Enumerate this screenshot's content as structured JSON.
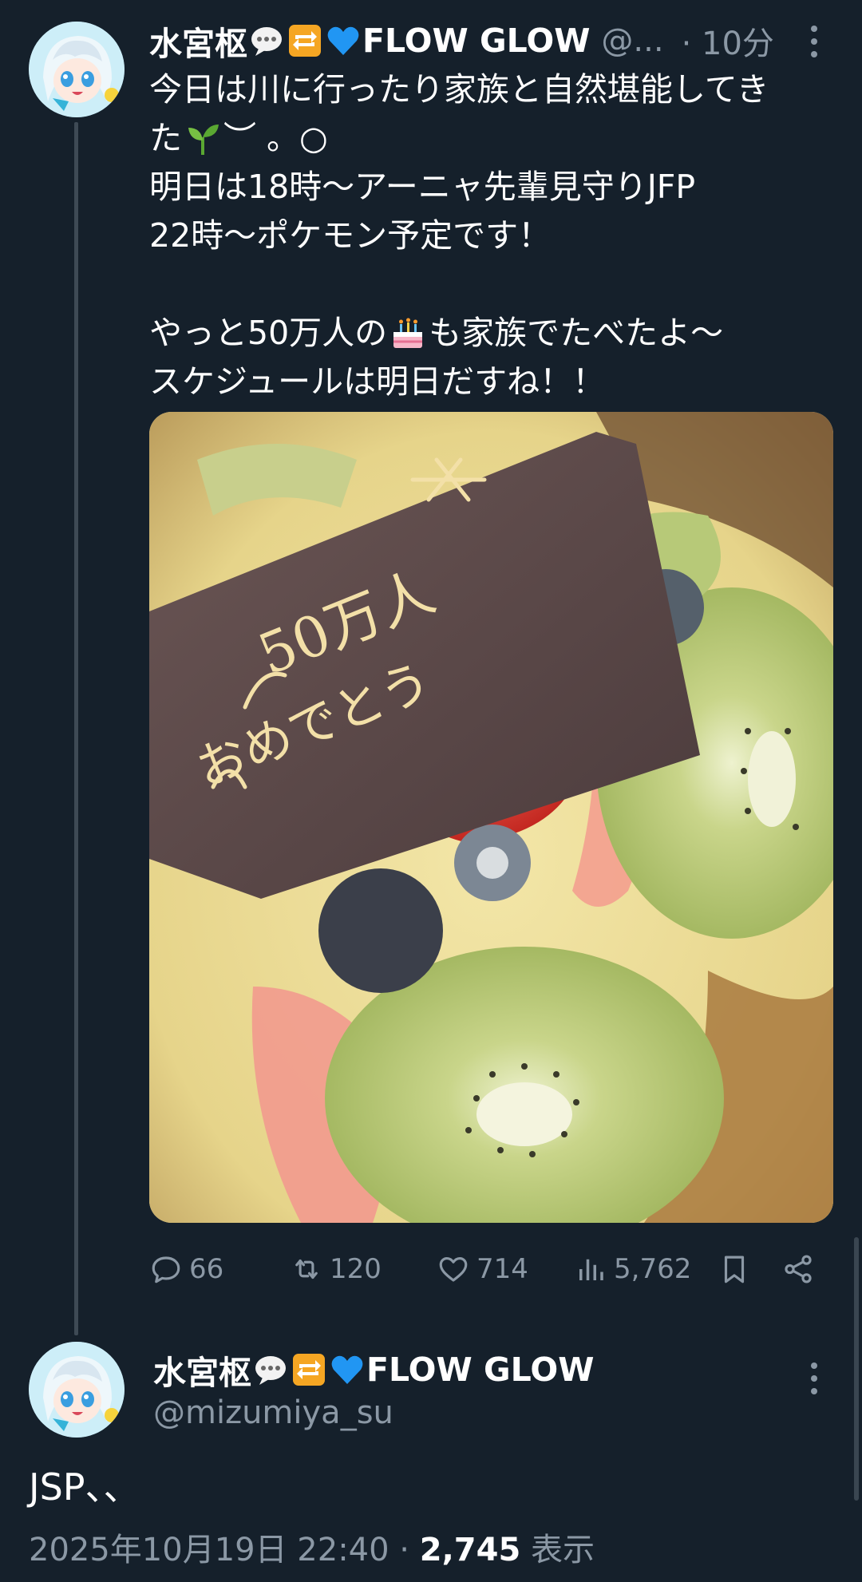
{
  "colors": {
    "background": "#15202b",
    "secondary_text": "#8b98a5",
    "primary_text": "#ffffff",
    "thread_line": "#3e4a55"
  },
  "tweet1": {
    "display_name_jp": "水宮枢",
    "display_name_en": "FLOW GLOW",
    "name_emojis": [
      "speech-bubble-emoji",
      "repeat-arrows-emoji",
      "blue-heart-emoji"
    ],
    "handle_truncated": "@...",
    "time": "· 10分",
    "body": {
      "line1": "今日は川に行ったり家族と自然堪能してき",
      "line2": "た",
      "line2_emoji": "seedling-emoji",
      "line2_tail": "︶ 。○",
      "line3": "明日は18時〜アーニャ先輩見守りJFP",
      "line4": "22時〜ポケモン予定です！",
      "line6_a": "やっと50万人の",
      "line6_emoji": "birthday-cake-emoji",
      "line6_b": "も家族でたべたよ〜",
      "line7": "スケジュールは明日だすね！！"
    },
    "image": {
      "subject": "fruit-tart-photo",
      "plaque_text_line1": "50万人",
      "plaque_text_line2": "おめでとう"
    },
    "actions": {
      "replies": "66",
      "retweets": "120",
      "likes": "714",
      "views": "5,762"
    }
  },
  "tweet2": {
    "display_name_jp": "水宮枢",
    "display_name_en": "FLOW GLOW",
    "handle": "@mizumiya_su",
    "text": "JSP、、",
    "timestamp": "2025年10月19日 22:40",
    "separator": " · ",
    "views_count": "2,745",
    "views_label": "表示"
  }
}
